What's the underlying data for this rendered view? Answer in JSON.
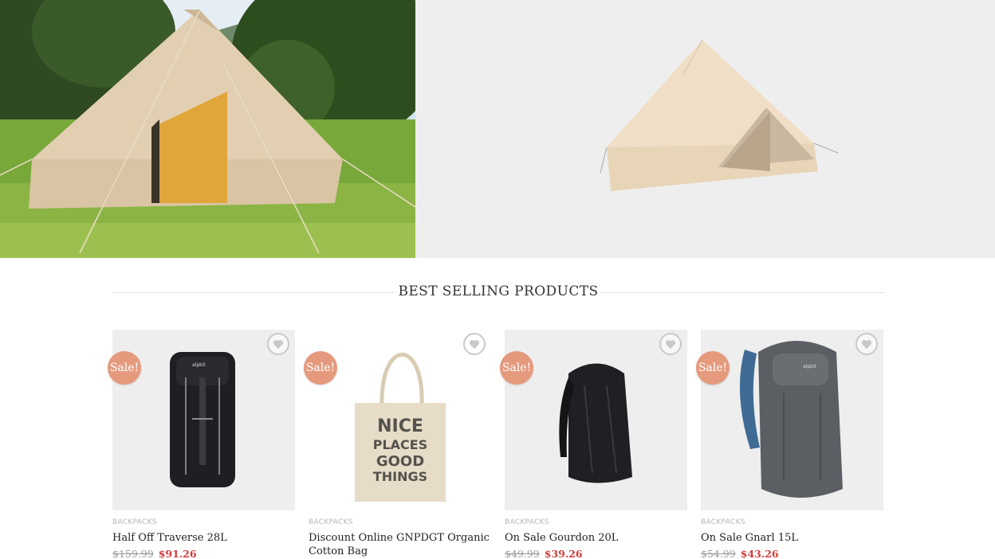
{
  "hero": {
    "left_image": "bell-tent-in-field-photo",
    "right_image": "bell-tent-product-photo"
  },
  "section": {
    "title": "BEST SELLING PRODUCTS"
  },
  "colors": {
    "sale_badge": "#e59a7e",
    "sale_price": "#d33b3b",
    "thumb_bg": "#eeeeee"
  },
  "products": [
    {
      "badge": "Sale!",
      "category": "BACKPACKS",
      "name": "Half Off Traverse 28L",
      "old_price": "$159.99",
      "new_price": "$91.26",
      "image": "black-backpack-tall",
      "wishlist_icon": "heart-icon"
    },
    {
      "badge": "Sale!",
      "category": "BACKPACKS",
      "name": "Discount Online GNPDGT Organic Cotton Bag",
      "old_price": "",
      "new_price": "",
      "image": "cotton-tote-bag-nice-places-good-things",
      "wishlist_icon": "heart-icon"
    },
    {
      "badge": "Sale!",
      "category": "BACKPACKS",
      "name": "On Sale Gourdon 20L",
      "old_price": "$49.99",
      "new_price": "$39.26",
      "image": "black-daypack",
      "wishlist_icon": "heart-icon"
    },
    {
      "badge": "Sale!",
      "category": "BACKPACKS",
      "name": "On Sale Gnarl 15L",
      "old_price": "$54.99",
      "new_price": "$43.26",
      "image": "grey-blue-backpack",
      "wishlist_icon": "heart-icon"
    }
  ]
}
